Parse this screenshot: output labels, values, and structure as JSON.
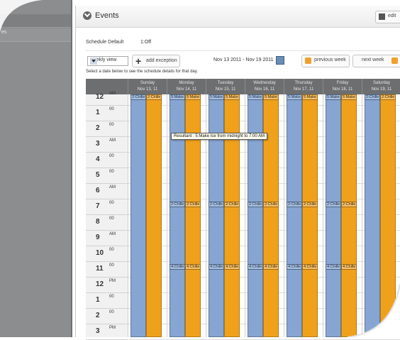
{
  "sidebar": {
    "item_label": "es"
  },
  "header": {
    "title": "Events",
    "edit_label": "edit"
  },
  "schedule": {
    "label": "Schedule Default",
    "value": "1:Off"
  },
  "toolbar": {
    "view_value": "weekly view",
    "add_exception_label": "add exception",
    "date_range": "Nov 13 2011 - Nov 19 2011",
    "previous_label": "previous week",
    "next_label": "next week"
  },
  "hint": "Select a date below to see the schedule details for that day.",
  "days": [
    {
      "name": "Sunday",
      "date": "Nov 13, 11"
    },
    {
      "name": "Monday",
      "date": "Nov 14, 11"
    },
    {
      "name": "Tuesday",
      "date": "Nov 15, 11"
    },
    {
      "name": "Wednesday",
      "date": "Nov 16, 11"
    },
    {
      "name": "Thursday",
      "date": "Nov 17, 11"
    },
    {
      "name": "Friday",
      "date": "Nov 18, 11"
    },
    {
      "name": "Saturday",
      "date": "Nov 19, 11"
    }
  ],
  "hours": [
    {
      "num": "12",
      "suf": "AM"
    },
    {
      "num": "1",
      "suf": "00"
    },
    {
      "num": "2",
      "suf": "00"
    },
    {
      "num": "3",
      "suf": "AM"
    },
    {
      "num": "4",
      "suf": "00"
    },
    {
      "num": "5",
      "suf": "00"
    },
    {
      "num": "6",
      "suf": "AM"
    },
    {
      "num": "7",
      "suf": "00"
    },
    {
      "num": "8",
      "suf": "00"
    },
    {
      "num": "9",
      "suf": "AM"
    },
    {
      "num": "10",
      "suf": "00"
    },
    {
      "num": "11",
      "suf": "00"
    },
    {
      "num": "12",
      "suf": "PM"
    },
    {
      "num": "1",
      "suf": "00"
    },
    {
      "num": "2",
      "suf": "00"
    },
    {
      "num": "3",
      "suf": "PM"
    }
  ],
  "events": {
    "top_sunday": [
      "2:Chille",
      "2:Chille"
    ],
    "top_weekday": [
      "5:Make",
      "5:Make"
    ],
    "top_saturday": [
      "2:Chille",
      "2:Chille"
    ],
    "seven_am": [
      "2:Chille",
      "2:Chille"
    ],
    "eleven_am": [
      "4:Chille",
      "4:Chille"
    ]
  },
  "tooltip": "Resultant : 5:Make Ice from midnight to 7:00 AM",
  "colors": {
    "blue_bar": "#87a5d2",
    "orange_bar": "#f0a11c",
    "header_bg": "#6d6e70",
    "sidebar_bg": "#8c8d8f"
  }
}
